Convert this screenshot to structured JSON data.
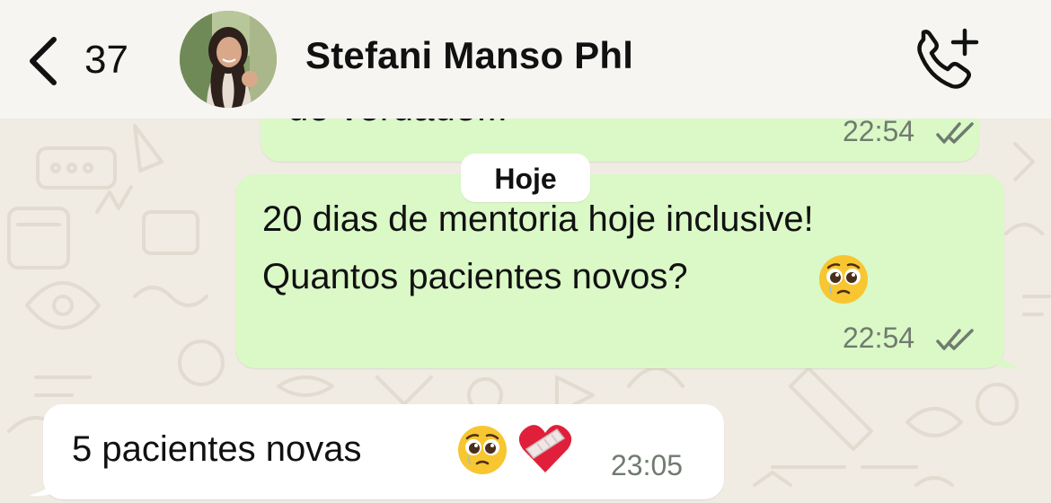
{
  "header": {
    "back_count": "37",
    "contact_name": "Stefani Manso Phl"
  },
  "icons": {
    "back": "chevron-left-icon",
    "call": "add-call-icon",
    "read": "double-check-icon",
    "emoji_teary": "pleading-face-emoji",
    "emoji_heart": "mending-heart-emoji"
  },
  "colors": {
    "outgoing_bubble": "#dbf8c7",
    "incoming_bubble": "#ffffff",
    "wallpaper": "#f0ebe3",
    "header": "#f6f5f2",
    "tick_gray": "#707b70"
  },
  "messages": {
    "previous": {
      "text_partial": "de verdade...",
      "time": "22:54"
    },
    "date_divider": "Hoje",
    "outgoing": {
      "line1": "20 dias de mentoria hoje inclusive!",
      "line2": "Quantos pacientes novos?",
      "time": "22:54"
    },
    "incoming": {
      "text": "5 pacientes novas",
      "time": "23:05"
    }
  }
}
